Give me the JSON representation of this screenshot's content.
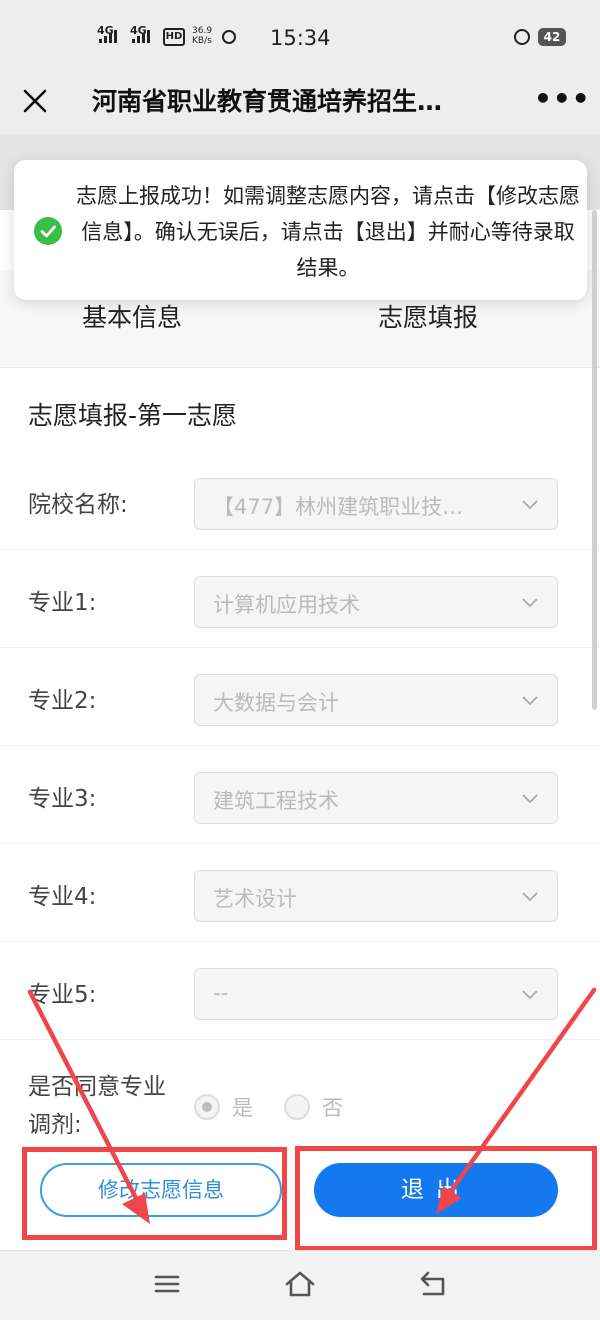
{
  "status_bar": {
    "network1": "4G",
    "network2": "4G",
    "hd_badge": "HD",
    "speed_value": "36.9",
    "speed_unit": "KB/s",
    "time": "15:34",
    "battery": "42"
  },
  "title_bar": {
    "title": "河南省职业教育贯通培养招生…",
    "close_icon": "close-icon",
    "more_icon": "more-icon"
  },
  "toast": {
    "icon": "check-circle-icon",
    "color": "#3bbd4a",
    "message": "志愿上报成功！如需调整志愿内容，请点击【修改志愿信息】。确认无误后，请点击【退出】并耐心等待录取结果。"
  },
  "tabs": [
    {
      "label": "基本信息"
    },
    {
      "label": "志愿填报"
    }
  ],
  "form": {
    "section_title": "志愿填报-第一志愿",
    "fields": [
      {
        "label": "院校名称:",
        "value": "【477】林州建筑职业技…"
      },
      {
        "label": "专业1:",
        "value": "计算机应用技术"
      },
      {
        "label": "专业2:",
        "value": "大数据与会计"
      },
      {
        "label": "专业3:",
        "value": "建筑工程技术"
      },
      {
        "label": "专业4:",
        "value": "艺术设计"
      },
      {
        "label": "专业5:",
        "value": "--"
      }
    ],
    "adjust_label": "是否同意专业调剂:",
    "adjust_options": [
      {
        "label": "是",
        "selected": true
      },
      {
        "label": "否",
        "selected": false
      }
    ]
  },
  "buttons": {
    "modify": "修改志愿信息",
    "exit": "退出"
  },
  "colors": {
    "primary": "#1478f0",
    "outline": "#3a9ee8",
    "annotation": "#f0464b"
  },
  "nav_bar": {
    "icons": [
      "menu-icon",
      "home-icon",
      "back-icon"
    ]
  }
}
